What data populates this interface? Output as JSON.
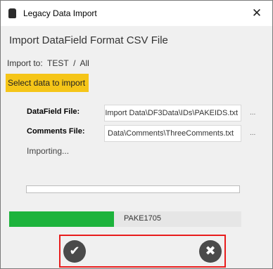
{
  "window": {
    "title": "Legacy Data Import",
    "close_glyph": "✕"
  },
  "header": {
    "title": "Import DataField Format CSV File"
  },
  "import_to": {
    "label": "Import to:",
    "value": "TEST  /  All"
  },
  "select_button": {
    "label": "Select data to import",
    "color": "#f5c518"
  },
  "fields": {
    "datafield": {
      "label": "DataField File:",
      "value": "Import Data\\DF3Data\\IDs\\PAKEIDS.txt",
      "browse": "..."
    },
    "comments": {
      "label": "Comments File:",
      "value": "Data\\Comments\\ThreeComments.txt",
      "browse": "..."
    }
  },
  "status": {
    "text": "Importing..."
  },
  "progress_overall": {
    "value": 0
  },
  "progress_item": {
    "value": 0.45,
    "text": "PAKE1705",
    "color": "#1db33c"
  },
  "actions": {
    "ok_icon": "check-icon",
    "cancel_icon": "x-icon",
    "ok_glyph": "✔",
    "cancel_glyph": "✖",
    "highlight_color": "#e81c1c"
  }
}
